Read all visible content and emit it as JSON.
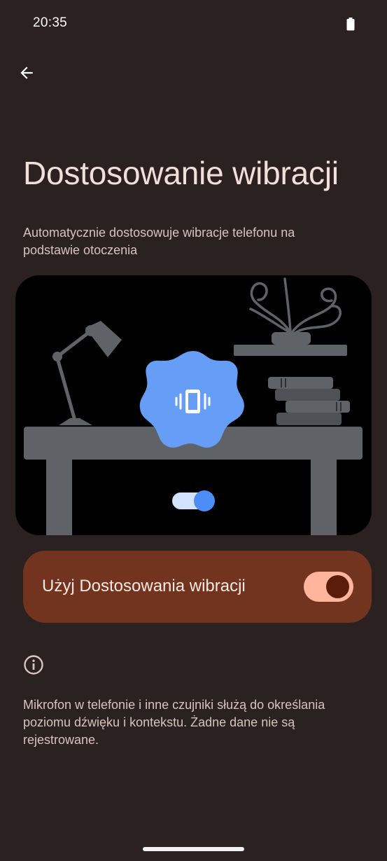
{
  "status_bar": {
    "time": "20:35"
  },
  "header": {
    "title": "Dostosowanie wibracji",
    "subtitle": "Automatycznie dostosowuje wibracje telefonu na podstawie otoczenia"
  },
  "toggle": {
    "label": "Użyj Dostosowania wibracji",
    "checked": true,
    "track_color": "#ffb59c",
    "thumb_color": "#5b1d0a"
  },
  "footer": {
    "info_text": "Mikrofon w telefonie i inne czujniki służą do określania poziomu dźwięku i kontekstu. Żadne dane nie są rejestrowane."
  },
  "colors": {
    "background": "#2a2120",
    "card": "#73341f",
    "accent_blue": "#669df6"
  },
  "icons": {
    "back": "arrow-back-icon",
    "battery": "battery-icon",
    "info": "info-icon",
    "vibration": "vibration-icon"
  }
}
